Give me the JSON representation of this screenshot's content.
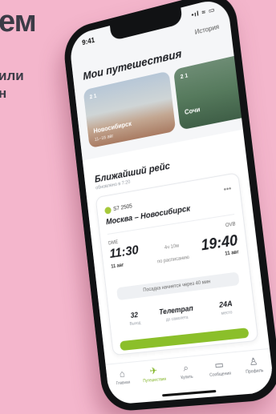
{
  "background": {
    "title_fragment": "ем",
    "subtitle_lines": [
      "или",
      "н"
    ],
    "color": "#f4b6cc"
  },
  "statusbar": {
    "time": "9:41",
    "right": "•ıl ≈ ▭"
  },
  "header": {
    "history_label": "История",
    "trips_title": "Мои путешествия"
  },
  "trips": [
    {
      "badge": "2  1",
      "city": "Новосибирск",
      "date": "11–16 авг"
    },
    {
      "badge": "2  1",
      "city": "Сочи",
      "date": ""
    }
  ],
  "nearest": {
    "title": "Ближайший рейс",
    "updated": "обновлено в 7:20"
  },
  "flight": {
    "number": "S7 2505",
    "route": "Москва – Новосибирск",
    "dep_code": "DME",
    "dep_time": "11:30",
    "dep_date": "11 авг",
    "arr_code": "OVB",
    "arr_time": "19:40",
    "arr_date": "11 авг",
    "duration": "4ч 10м",
    "schedule": "по расписанию",
    "boarding_note": "Посадка начнется через 40 мин",
    "gate_value": "32",
    "gate_label": "Выход",
    "transport_value": "Телетрап",
    "transport_label": "до самолета",
    "seat_value": "24A",
    "seat_label": "место"
  },
  "tabs": [
    {
      "label": "Главная",
      "icon": "home-icon"
    },
    {
      "label": "Путешествия",
      "icon": "plane-icon"
    },
    {
      "label": "Купить",
      "icon": "search-icon"
    },
    {
      "label": "Сообщения",
      "icon": "chat-icon"
    },
    {
      "label": "Профиль",
      "icon": "profile-icon"
    }
  ],
  "accent_color": "#8bbf2a"
}
